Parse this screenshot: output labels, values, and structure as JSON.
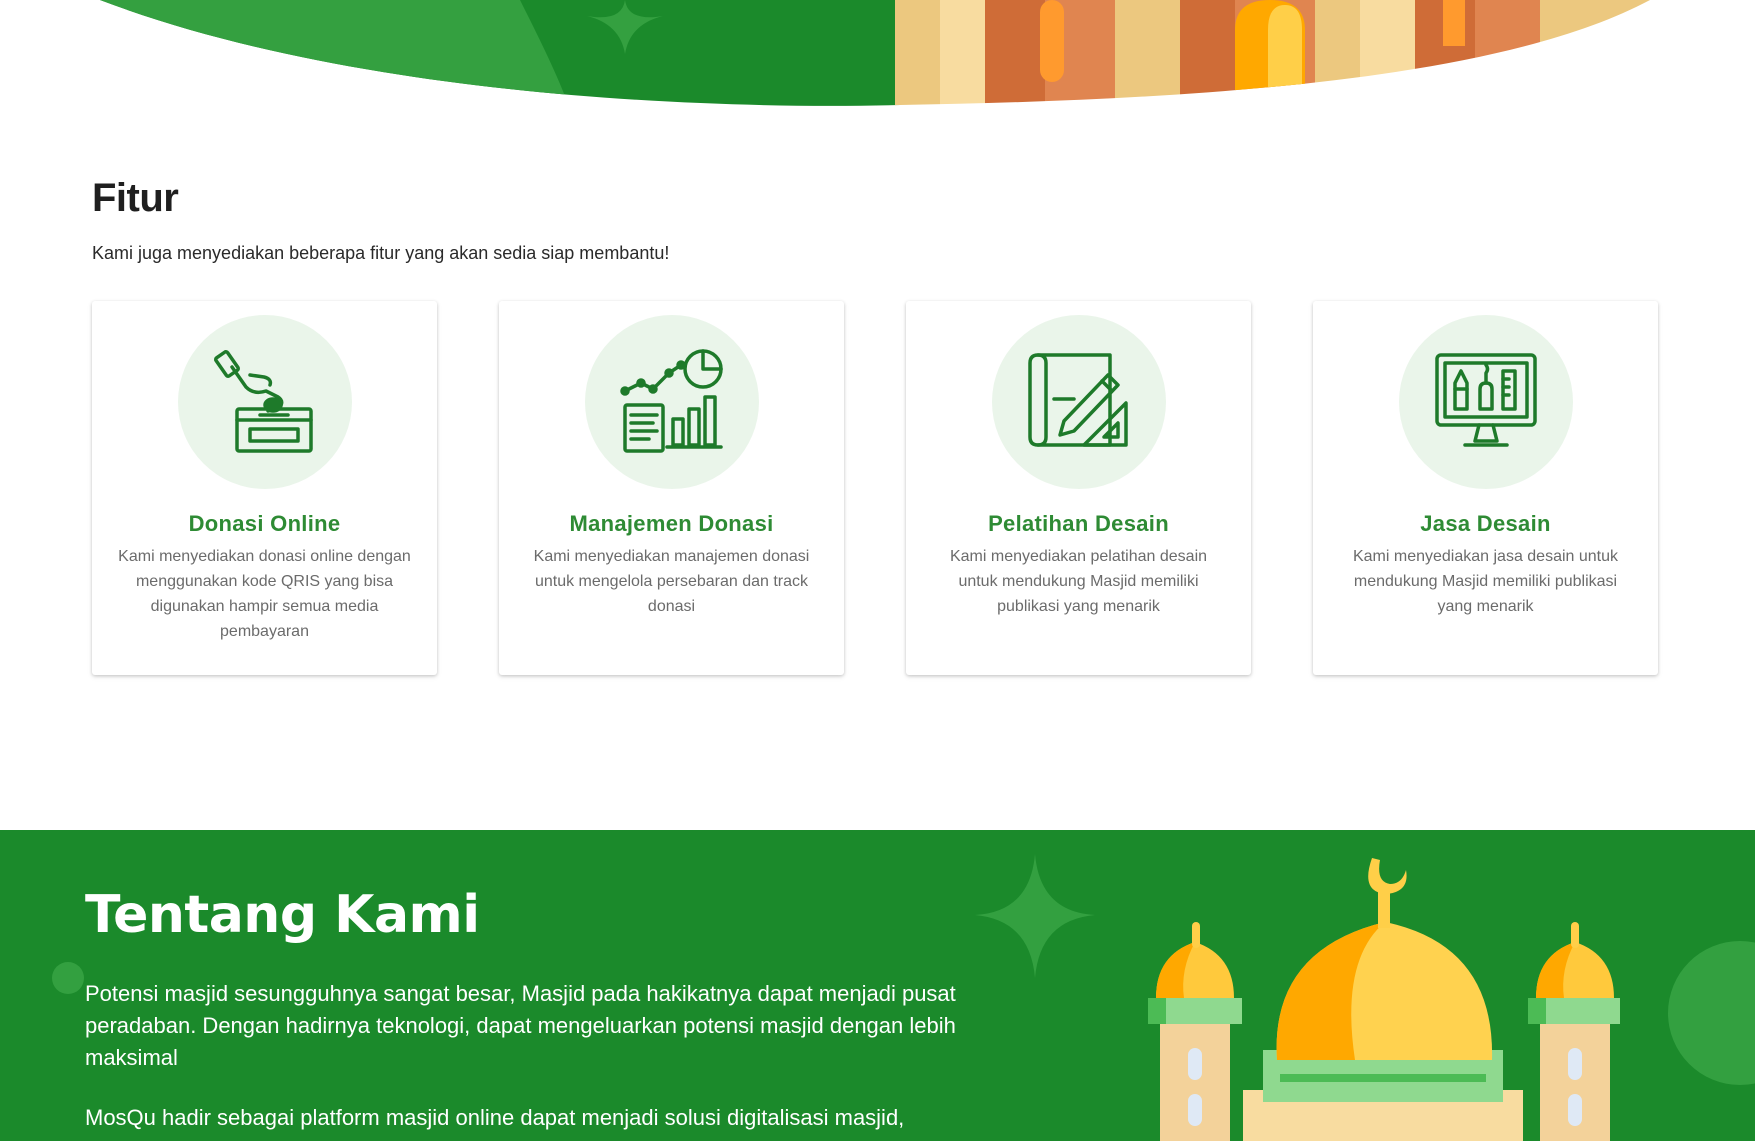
{
  "colors": {
    "brand_green": "#1b8a2b",
    "title_green": "#2e8b34",
    "icon_circle_bg": "#eaf5ea"
  },
  "features": {
    "title": "Fitur",
    "subtitle": "Kami juga menyediakan beberapa fitur yang akan sedia siap membantu!",
    "cards": [
      {
        "icon": "donation-box-icon",
        "title": "Donasi Online",
        "description": "Kami menyediakan donasi online dengan menggunakan kode QRIS yang bisa digunakan hampir semua media pembayaran"
      },
      {
        "icon": "analytics-report-icon",
        "title": "Manajemen Donasi",
        "description": "Kami menyediakan manajemen donasi untuk mengelola persebaran dan track donasi"
      },
      {
        "icon": "design-blueprint-icon",
        "title": "Pelatihan Desain",
        "description": "Kami menyediakan pelatihan desain untuk mendukung Masjid memiliki publikasi yang menarik"
      },
      {
        "icon": "design-monitor-icon",
        "title": "Jasa Desain",
        "description": "Kami menyediakan jasa desain untuk mendukung Masjid memiliki publikasi yang menarik"
      }
    ]
  },
  "about": {
    "title": "Tentang Kami",
    "paragraph_1": "Potensi masjid sesungguhnya sangat besar, Masjid pada hakikatnya dapat menjadi pusat peradaban. Dengan hadirnya teknologi, dapat mengeluarkan potensi masjid dengan lebih maksimal",
    "paragraph_2": "MosQu hadir sebagai platform masjid online dapat menjadi solusi digitalisasi masjid,",
    "illustration": "mosque-illustration"
  }
}
